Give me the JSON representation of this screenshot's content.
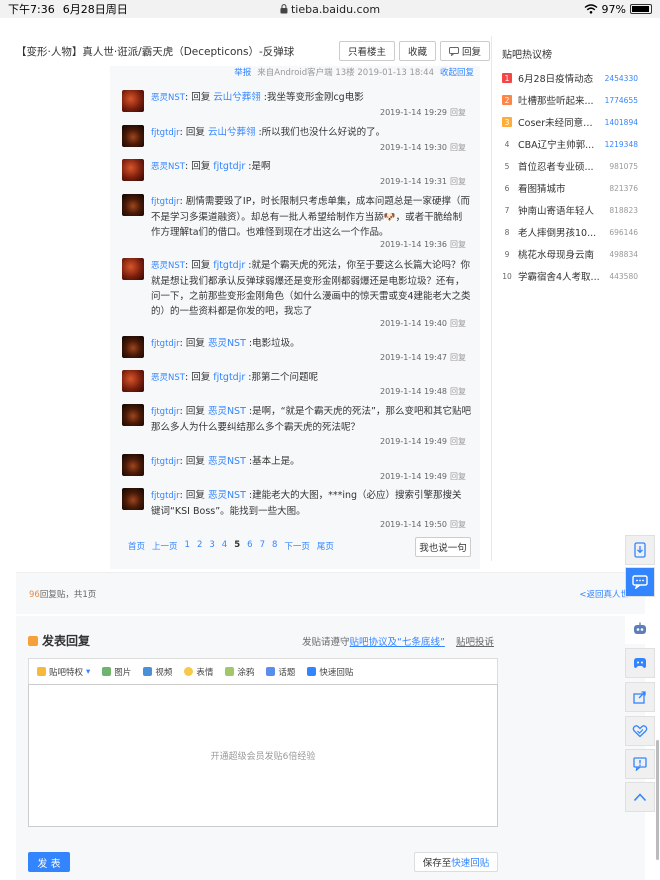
{
  "statusbar": {
    "time": "下午7:36",
    "date": "6月28日周日",
    "url": "tieba.baidu.com",
    "battery": "97%",
    "battery_level": 0.97
  },
  "header": {
    "title": "【变形·人物】真人世·诳派/霸天虎（Decepticons）-反弹球",
    "only_op": "只看楼主",
    "favorite": "收藏",
    "reply": "回复"
  },
  "prevline": {
    "text": "来自Android客户端 13楼 2019-01-13 18:44",
    "report": "举报",
    "collapse": "收起回复"
  },
  "replies": [
    {
      "user": "恶灵NST",
      "avatar": "red",
      "pre": "回复 ",
      "mention": "云山兮葬翎",
      "text": " :我坐等变形金刚cg电影",
      "time": "2019-1-14 19:29",
      "reply_label": "回复"
    },
    {
      "user": "fjtgtdjr",
      "avatar": "dark",
      "pre": "回复 ",
      "mention": "云山兮葬翎",
      "text": " :所以我们也没什么好说的了。",
      "time": "2019-1-14 19:30",
      "reply_label": "回复"
    },
    {
      "user": "恶灵NST",
      "avatar": "red",
      "pre": "回复 ",
      "mention": "fjtgtdjr",
      "text": " :是啊",
      "time": "2019-1-14 19:31",
      "reply_label": "回复"
    },
    {
      "user": "fjtgtdjr",
      "avatar": "dark",
      "pre": "",
      "mention": "",
      "text": "剧情需要毁了IP，时长限制只考虑单集，成本问题总是一家硬撑（而不是学习多渠道融资）。却总有一批人希望给制作方当舔🐶，或者干脆给制作方理解ta们的借口。也难怪到现在才出这么一个作品。",
      "time": "2019-1-14 19:36",
      "reply_label": "回复"
    },
    {
      "user": "恶灵NST",
      "avatar": "red",
      "pre": "回复 ",
      "mention": "fjtgtdjr",
      "text": " :就是个霸天虎的死法，你至于要这么长篇大论吗？你就是想让我们都承认反弹球弱爆还是变形金刚都弱爆还是电影垃圾？还有，问一下，之前那些变形金刚角色（如什么漫画中的惊天雷或变4建能老大之类的）的一些资料都是你发的吧，我忘了",
      "time": "2019-1-14 19:40",
      "reply_label": "回复"
    },
    {
      "user": "fjtgtdjr",
      "avatar": "dark",
      "pre": "回复 ",
      "mention": "恶灵NST",
      "text": " :电影垃圾。",
      "time": "2019-1-14 19:47",
      "reply_label": "回复"
    },
    {
      "user": "恶灵NST",
      "avatar": "red",
      "pre": "回复 ",
      "mention": "fjtgtdjr",
      "text": " :那第二个问题呢",
      "time": "2019-1-14 19:48",
      "reply_label": "回复"
    },
    {
      "user": "fjtgtdjr",
      "avatar": "dark",
      "pre": "回复 ",
      "mention": "恶灵NST",
      "text": " :是啊，“就是个霸天虎的死法”，那么变吧和其它贴吧那么多人为什么要纠结那么多个霸天虎的死法呢？",
      "time": "2019-1-14 19:49",
      "reply_label": "回复"
    },
    {
      "user": "fjtgtdjr",
      "avatar": "dark",
      "pre": "回复 ",
      "mention": "恶灵NST",
      "text": " :基本上是。",
      "time": "2019-1-14 19:49",
      "reply_label": "回复"
    },
    {
      "user": "fjtgtdjr",
      "avatar": "dark",
      "pre": "回复 ",
      "mention": "恶灵NST",
      "text": " :建能老大的大图，***ing（必应）搜索引擎那搜关键词“KSI Boss”。能找到一些大图。",
      "time": "2019-1-14 19:50",
      "reply_label": "回复"
    }
  ],
  "pager": {
    "first": "首页",
    "prev": "上一页",
    "pages": [
      "1",
      "2",
      "3",
      "4",
      "5",
      "6",
      "7",
      "8"
    ],
    "current": "5",
    "next": "下一页",
    "last": "尾页",
    "say": "我也说一句"
  },
  "summary": {
    "count": "96",
    "count_suffix": "回复贴，共",
    "pages": "1",
    "pages_suffix": "页",
    "back": "<返回真人世"
  },
  "composer": {
    "title": "发表回复",
    "rules_pre": "发贴请遵守",
    "rules_link": "贴吧协议及“七条底线”",
    "complain": "贴吧投诉",
    "tools": [
      "贴吧特权",
      "图片",
      "视频",
      "表情",
      "涂鸦",
      "话题",
      "快速回贴"
    ],
    "placeholder": "开通超级会员发贴6倍经验",
    "submit": "发 表",
    "save_pre": "保存至",
    "save_link": "快速回贴"
  },
  "sidebar": {
    "title": "贴吧热议榜",
    "items": [
      {
        "rank": "1",
        "name": "6月28日疫情动态",
        "count": "2454330",
        "color": "#f54545"
      },
      {
        "rank": "2",
        "name": "吐槽那些听起来...",
        "count": "1774655",
        "color": "#ff8547"
      },
      {
        "rank": "3",
        "name": "Coser未经同意爬...",
        "count": "1401894",
        "color": "#ffac38"
      },
      {
        "rank": "4",
        "name": "CBA辽宁主帅郭...",
        "count": "1219348",
        "color": ""
      },
      {
        "rank": "5",
        "name": "首位忍者专业硕...",
        "count": "981075",
        "color": ""
      },
      {
        "rank": "6",
        "name": "看图猜城市",
        "count": "821376",
        "color": ""
      },
      {
        "rank": "7",
        "name": "钟南山寄语年轻人",
        "count": "818823",
        "color": ""
      },
      {
        "rank": "8",
        "name": "老人摔倒男孩10...",
        "count": "696146",
        "color": ""
      },
      {
        "rank": "9",
        "name": "桃花水母现身云南",
        "count": "498834",
        "color": ""
      },
      {
        "rank": "10",
        "name": "学霸宿舍4人考取...",
        "count": "443580",
        "color": ""
      }
    ]
  },
  "colors": {
    "accent": "#3385ff",
    "orange": "#f28a3c",
    "panel": "#f7f8fa"
  }
}
